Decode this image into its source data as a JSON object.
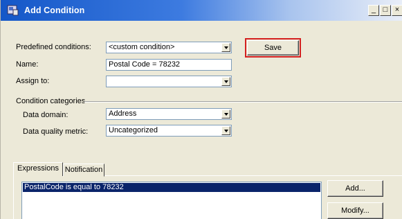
{
  "window": {
    "title": "Add Condition",
    "icon": "app-icon",
    "minimize_glyph": "_",
    "maximize_glyph": "□",
    "close_glyph": "×"
  },
  "form": {
    "predefined": {
      "label": "Predefined conditions:",
      "value": "<custom condition>"
    },
    "name": {
      "label": "Name:",
      "value": "Postal Code = 78232"
    },
    "assign": {
      "label": "Assign to:",
      "value": ""
    },
    "save_label": "Save"
  },
  "categories": {
    "group_label": "Condition categories",
    "data_domain": {
      "label": "Data domain:",
      "value": "Address"
    },
    "quality_metric": {
      "label": "Data quality metric:",
      "value": "Uncategorized"
    }
  },
  "tabs": [
    {
      "label": "Expressions",
      "selected": true
    },
    {
      "label": "Notification",
      "selected": false
    }
  ],
  "expressions": {
    "items": [
      "PostalCode is equal to 78232"
    ],
    "add_label": "Add...",
    "modify_label": "Modify..."
  },
  "colors": {
    "highlight": "#d42020",
    "selection": "#0a246a",
    "titlebar": "#1457c8"
  }
}
